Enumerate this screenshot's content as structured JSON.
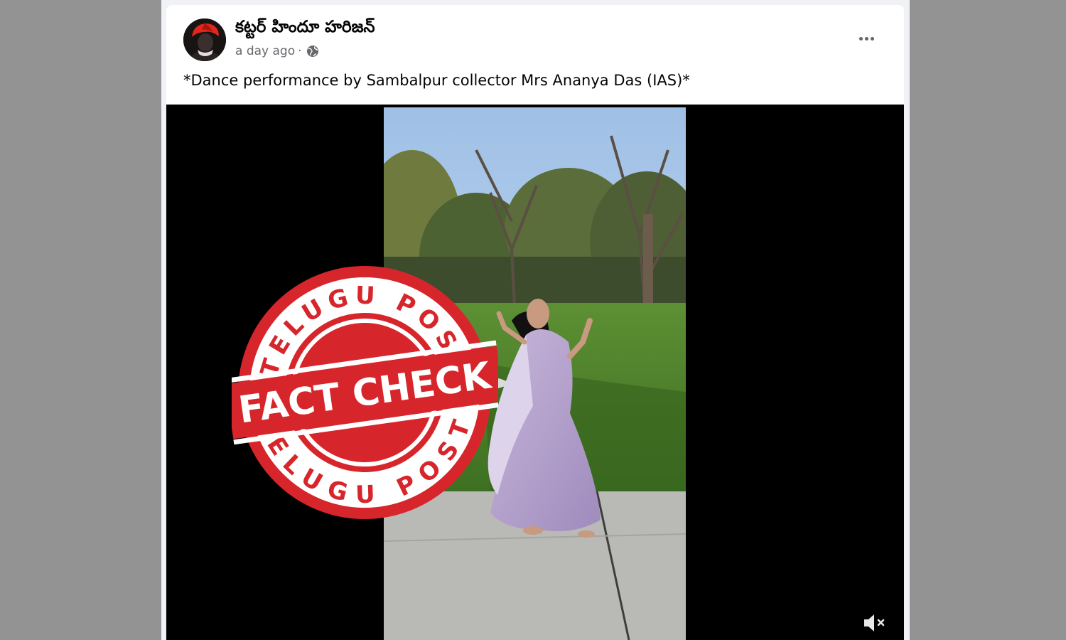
{
  "post": {
    "author_name": "కట్టర్ హిందూ హరిజన్",
    "timestamp": "a day ago",
    "separator": "·",
    "visibility_icon": "globe-icon",
    "more_icon": "more-options-icon",
    "caption": "*Dance performance by Sambalpur collector Mrs Ananya Das (IAS)*"
  },
  "video": {
    "mute_icon": "volume-muted-icon"
  },
  "stamp": {
    "top_text": "TELUGU POST",
    "center_text": "FACT CHECK",
    "bottom_text": "TELUGU POST",
    "color": "#d7262b"
  },
  "colors": {
    "page_background": "#939393",
    "card": "#ffffff",
    "video_background": "#000000",
    "secondary_text": "#65676b"
  }
}
